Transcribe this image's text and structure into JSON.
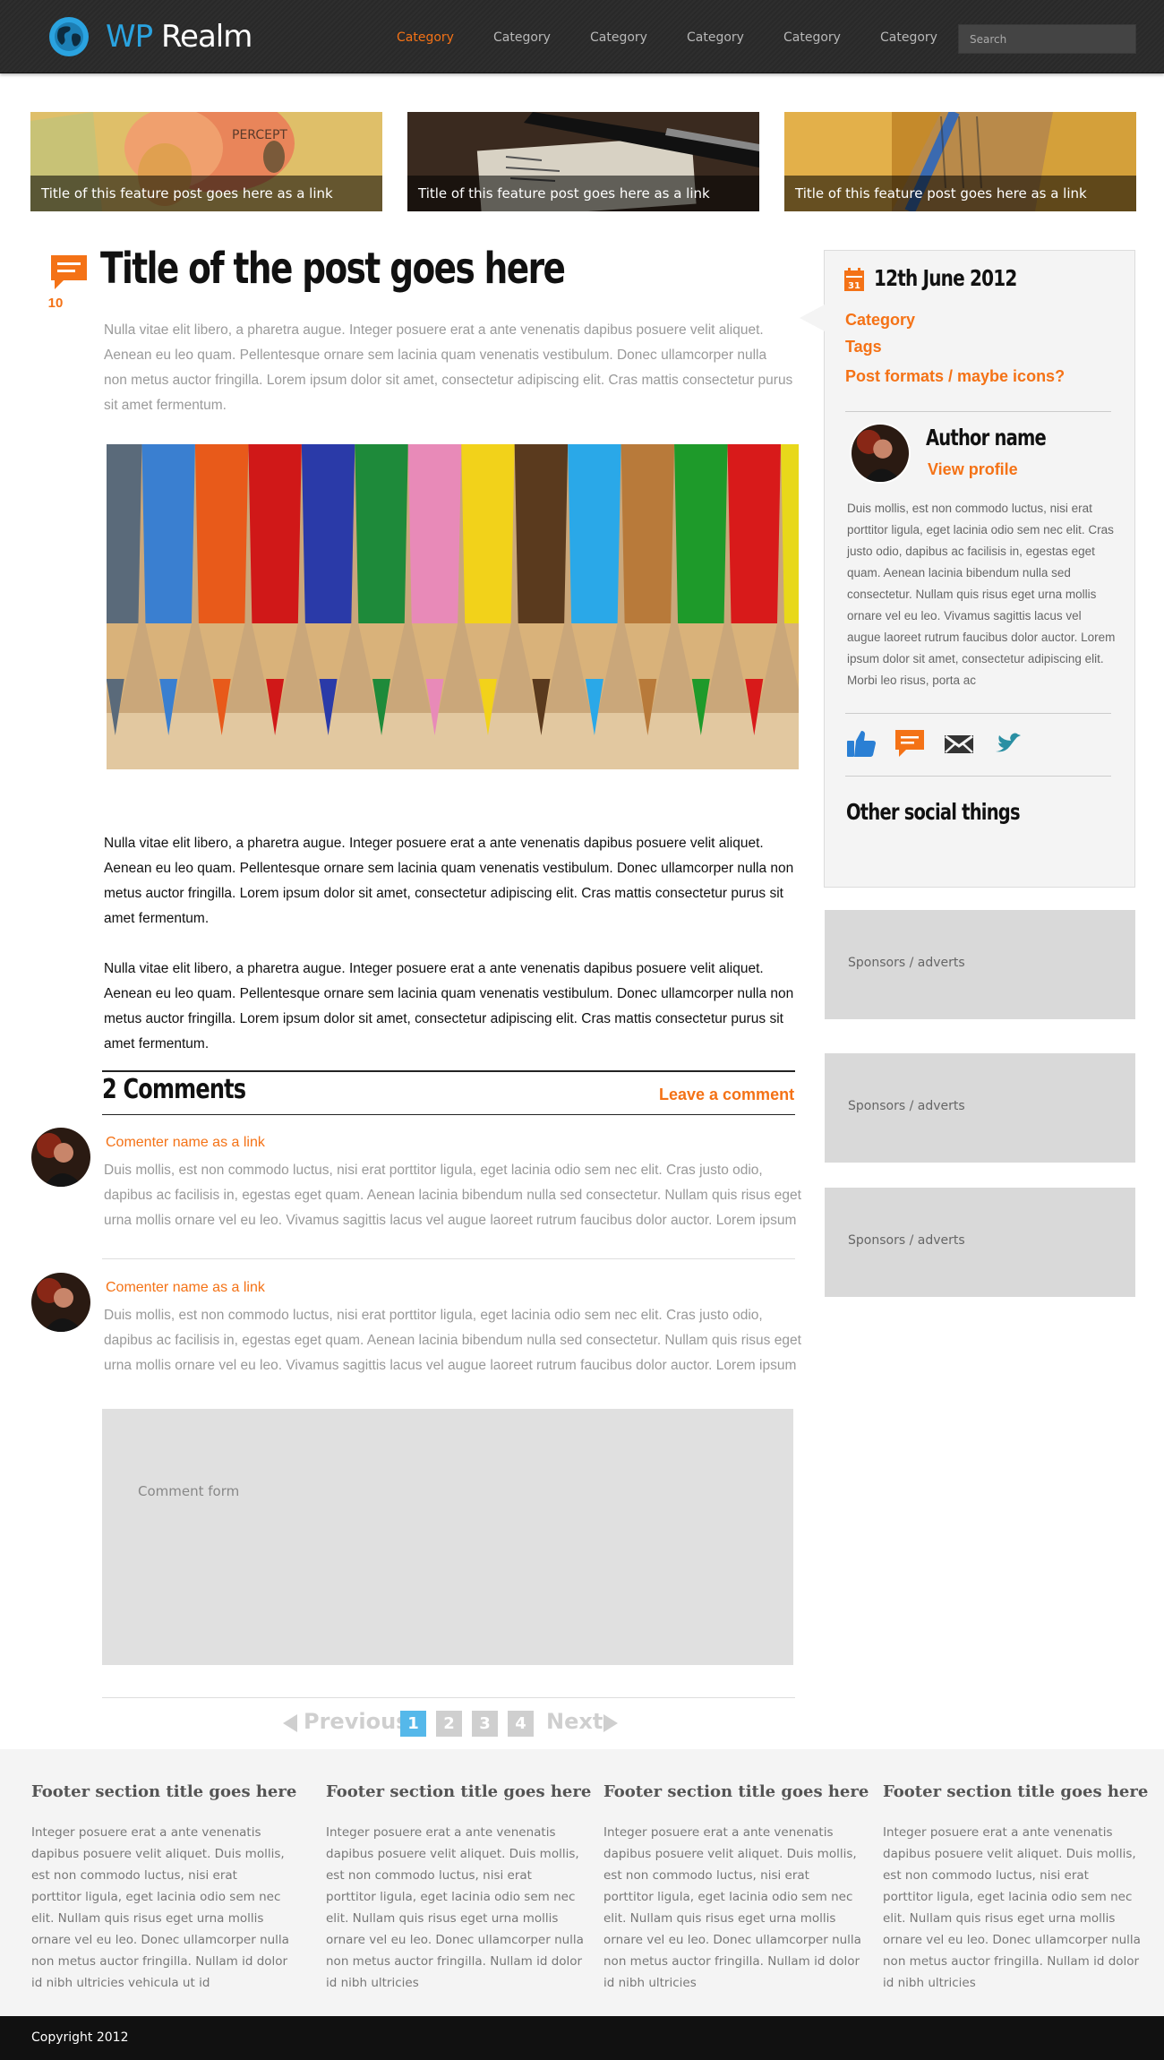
{
  "header": {
    "logo_wp": "WP",
    "logo_realm": "Realm",
    "nav": [
      "Category",
      "Category",
      "Category",
      "Category",
      "Category",
      "Category"
    ],
    "search_placeholder": "Search"
  },
  "features": [
    {
      "caption": "Title of this feature post goes here as a link"
    },
    {
      "caption": "Title of this feature post goes here as a link"
    },
    {
      "caption": "Title of this feature post goes here as a link"
    }
  ],
  "post": {
    "comment_count": "10",
    "title": "Title of the post goes here",
    "intro": "Nulla vitae elit libero, a pharetra augue. Integer posuere erat a ante venenatis dapibus posuere velit aliquet. Aenean eu leo quam. Pellentesque ornare sem lacinia quam venenatis vestibulum. Donec ullamcorper nulla non metus auctor fringilla. Lorem ipsum dolor sit amet, consectetur adipiscing elit. Cras mattis consectetur purus sit amet fermentum.",
    "body": [
      "Nulla vitae elit libero, a pharetra augue. Integer posuere erat a ante venenatis dapibus posuere velit aliquet. Aenean eu leo quam. Pellentesque ornare sem lacinia quam venenatis vestibulum. Donec ullamcorper nulla non metus auctor fringilla. Lorem ipsum dolor sit amet, consectetur adipiscing elit. Cras mattis consectetur purus sit amet fermentum.",
      "Nulla vitae elit libero, a pharetra augue. Integer posuere erat a ante venenatis dapibus posuere velit aliquet. Aenean eu leo quam. Pellentesque ornare sem lacinia quam venenatis vestibulum. Donec ullamcorper nulla non metus auctor fringilla. Lorem ipsum dolor sit amet, consectetur adipiscing elit. Cras mattis consectetur purus sit amet fermentum."
    ]
  },
  "comments_section": {
    "title": "2 Comments",
    "leave_comment": "Leave a comment",
    "comments": [
      {
        "name": "Comenter name as a link",
        "text": "Duis mollis, est non commodo luctus, nisi erat porttitor ligula, eget lacinia odio sem nec elit. Cras justo odio, dapibus ac facilisis in, egestas eget quam. Aenean lacinia bibendum nulla sed consectetur. Nullam quis risus eget urna mollis ornare vel eu leo. Vivamus sagittis lacus vel augue laoreet rutrum faucibus dolor auctor. Lorem ipsum"
      },
      {
        "name": "Comenter name as a link",
        "text": "Duis mollis, est non commodo luctus, nisi erat porttitor ligula, eget lacinia odio sem nec elit. Cras justo odio, dapibus ac facilisis in, egestas eget quam. Aenean lacinia bibendum nulla sed consectetur. Nullam quis risus eget urna mollis ornare vel eu leo. Vivamus sagittis lacus vel augue laoreet rutrum faucibus dolor auctor. Lorem ipsum"
      }
    ],
    "form_label": "Comment form"
  },
  "pager": {
    "previous": "Previous",
    "next": "Next",
    "pages": [
      "1",
      "2",
      "3",
      "4"
    ],
    "current": "1"
  },
  "sidebar": {
    "calendar_day": "31",
    "date": "12th June 2012",
    "meta_links": [
      "Category",
      "Tags",
      "Post formats / maybe icons?"
    ],
    "author_name": "Author name",
    "view_profile": "View profile",
    "author_bio": "Duis mollis, est non commodo luctus, nisi erat porttitor ligula, eget lacinia odio sem nec elit. Cras justo odio, dapibus ac facilisis in, egestas eget quam. Aenean lacinia bibendum nulla sed consectetur. Nullam quis risus eget urna mollis ornare vel eu leo. Vivamus sagittis lacus vel augue laoreet rutrum faucibus dolor auctor. Lorem ipsum dolor sit amet, consectetur adipiscing elit. Morbi leo risus, porta ac",
    "social_icons": [
      "thumbs-up-icon",
      "comment-icon",
      "mail-icon",
      "twitter-bird-icon"
    ],
    "other_social": "Other social things",
    "sponsors": [
      "Sponsors / adverts",
      "Sponsors / adverts",
      "Sponsors / adverts"
    ]
  },
  "footer": {
    "sections": [
      {
        "title": "Footer section title goes here",
        "text": "Integer posuere erat a ante venenatis dapibus posuere velit aliquet. Duis mollis, est non commodo luctus, nisi erat porttitor ligula, eget lacinia odio sem nec elit. Nullam quis risus eget urna mollis ornare vel eu leo. Donec ullamcorper nulla non metus auctor fringilla. Nullam id dolor id nibh ultricies vehicula ut id"
      },
      {
        "title": "Footer section title goes here",
        "text": "Integer posuere erat a ante venenatis dapibus posuere velit aliquet. Duis mollis, est non commodo luctus, nisi erat porttitor ligula, eget lacinia odio sem nec elit. Nullam quis risus eget urna mollis ornare vel eu leo. Donec ullamcorper nulla non metus auctor fringilla. Nullam id dolor id nibh ultricies"
      },
      {
        "title": "Footer section title goes here",
        "text": "Integer posuere erat a ante venenatis dapibus posuere velit aliquet. Duis mollis, est non commodo luctus, nisi erat porttitor ligula, eget lacinia odio sem nec elit. Nullam quis risus eget urna mollis ornare vel eu leo. Donec ullamcorper nulla non metus auctor fringilla. Nullam id dolor id nibh ultricies"
      },
      {
        "title": "Footer section title goes here",
        "text": "Integer posuere erat a ante venenatis dapibus posuere velit aliquet. Duis mollis, est non commodo luctus, nisi erat porttitor ligula, eget lacinia odio sem nec elit. Nullam quis risus eget urna mollis ornare vel eu leo. Donec ullamcorper nulla non metus auctor fringilla. Nullam id dolor id nibh ultricies"
      }
    ],
    "copyright": "Copyright 2012"
  },
  "colors": {
    "accent_orange": "#f47216",
    "logo_blue": "#2aa3e0",
    "pager_active": "#55b8ea",
    "header_bg": "#2b2b2b",
    "footer_bg": "#f4f4f4"
  }
}
